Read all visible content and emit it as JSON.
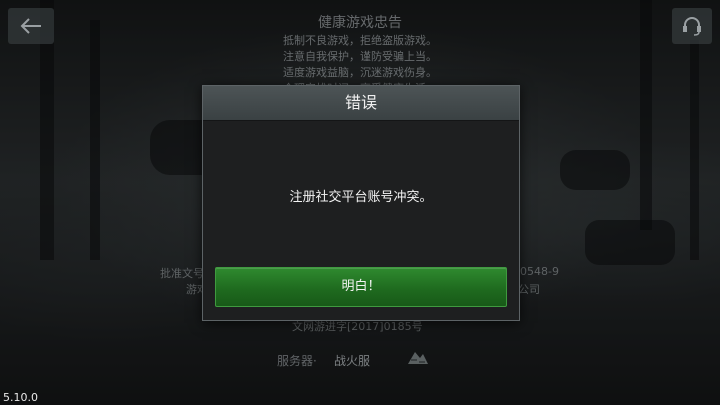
{
  "version": "5.10.0",
  "notice": {
    "title": "健康游戏忠告",
    "lines": [
      "抵制不良游戏，拒绝盗版游戏。",
      "注意自我保护，谨防受骗上当。",
      "适度游戏益脑，沉迷游戏伤身。",
      "合理安排时间，享受健康生活。"
    ]
  },
  "background_text": {
    "left_1": "批准文号",
    "left_2": "游戏",
    "right_1": "0548-9",
    "right_2": "公司",
    "bottom": "文网游进字[2017]0185号"
  },
  "server": {
    "label": "服务器·",
    "value": "战火服"
  },
  "dialog": {
    "title": "错误",
    "message": "注册社交平台账号冲突。",
    "ok_label": "明白！"
  },
  "icons": [
    "back-arrow-icon",
    "support-headset-icon",
    "server-icon"
  ]
}
